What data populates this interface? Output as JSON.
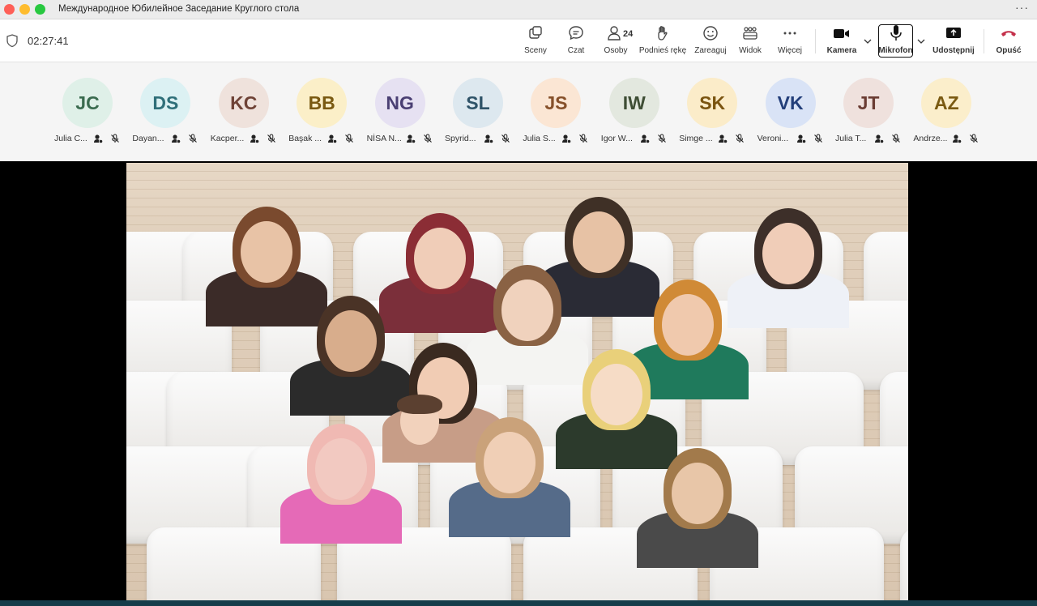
{
  "window": {
    "title": "Международное Юбилейное Заседание Круглого стола",
    "more_icon": "ellipsis-icon"
  },
  "toolbar": {
    "timer": "02:27:41",
    "buttons": {
      "scenes": "Sceny",
      "chat": "Czat",
      "people": "Osoby",
      "people_count": "24",
      "raise_hand": "Podnieś rękę",
      "react": "Zareaguj",
      "view": "Widok",
      "more": "Więcej",
      "camera": "Kamera",
      "mic": "Mikrofon",
      "share": "Udostępnij",
      "leave": "Opuść"
    },
    "leave_color": "#c4314b"
  },
  "participants": [
    {
      "initials": "JC",
      "name": "Julia C...",
      "bg": "#dff0e8",
      "fg": "#3a6b4f"
    },
    {
      "initials": "DS",
      "name": "Dayan...",
      "bg": "#dcf1f3",
      "fg": "#2f6f79"
    },
    {
      "initials": "KC",
      "name": "Kacper...",
      "bg": "#efe2dc",
      "fg": "#6e4236"
    },
    {
      "initials": "BB",
      "name": "Başak ...",
      "bg": "#fbefc8",
      "fg": "#7a5a12"
    },
    {
      "initials": "NG",
      "name": "NİSA N...",
      "bg": "#e6e1f2",
      "fg": "#4a3f73"
    },
    {
      "initials": "SL",
      "name": "Spyrid...",
      "bg": "#dde8ef",
      "fg": "#2f5368"
    },
    {
      "initials": "JS",
      "name": "Julia S...",
      "bg": "#fbe6d4",
      "fg": "#86502a"
    },
    {
      "initials": "IW",
      "name": "Igor W...",
      "bg": "#e3e8df",
      "fg": "#3f4e35"
    },
    {
      "initials": "SK",
      "name": "Simge ...",
      "bg": "#fbecc9",
      "fg": "#7a5410"
    },
    {
      "initials": "VK",
      "name": "Veroni...",
      "bg": "#d9e3f6",
      "fg": "#233f7a"
    },
    {
      "initials": "JT",
      "name": "Julia T...",
      "bg": "#efe1dd",
      "fg": "#6a3c33"
    },
    {
      "initials": "AZ",
      "name": "Andrze...",
      "bg": "#fbeecb",
      "fg": "#7a5a12"
    }
  ]
}
